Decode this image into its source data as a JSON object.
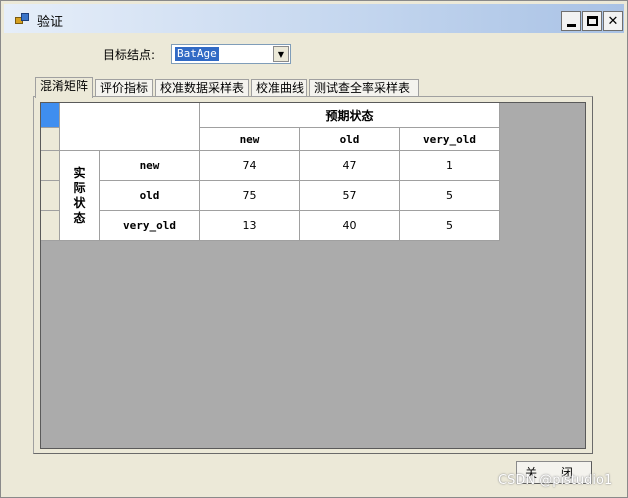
{
  "window": {
    "title": "验证"
  },
  "form": {
    "target_label": "目标结点:",
    "target_value": "BatAge"
  },
  "tabs": [
    "混淆矩阵",
    "评价指标",
    "校准数据采样表",
    "校准曲线",
    "测试查全率采样表"
  ],
  "matrix": {
    "predicted_header": "预期状态",
    "actual_header": "实际状态",
    "columns": [
      "new",
      "old",
      "very_old"
    ],
    "rows": [
      {
        "label": "new",
        "values": [
          "74",
          "47",
          "1"
        ]
      },
      {
        "label": "old",
        "values": [
          "75",
          "57",
          "5"
        ]
      },
      {
        "label": "very_old",
        "values": [
          "13",
          "40",
          "5"
        ]
      }
    ]
  },
  "buttons": {
    "close": "关 闭"
  },
  "watermark": "CSDN @pistudio1"
}
